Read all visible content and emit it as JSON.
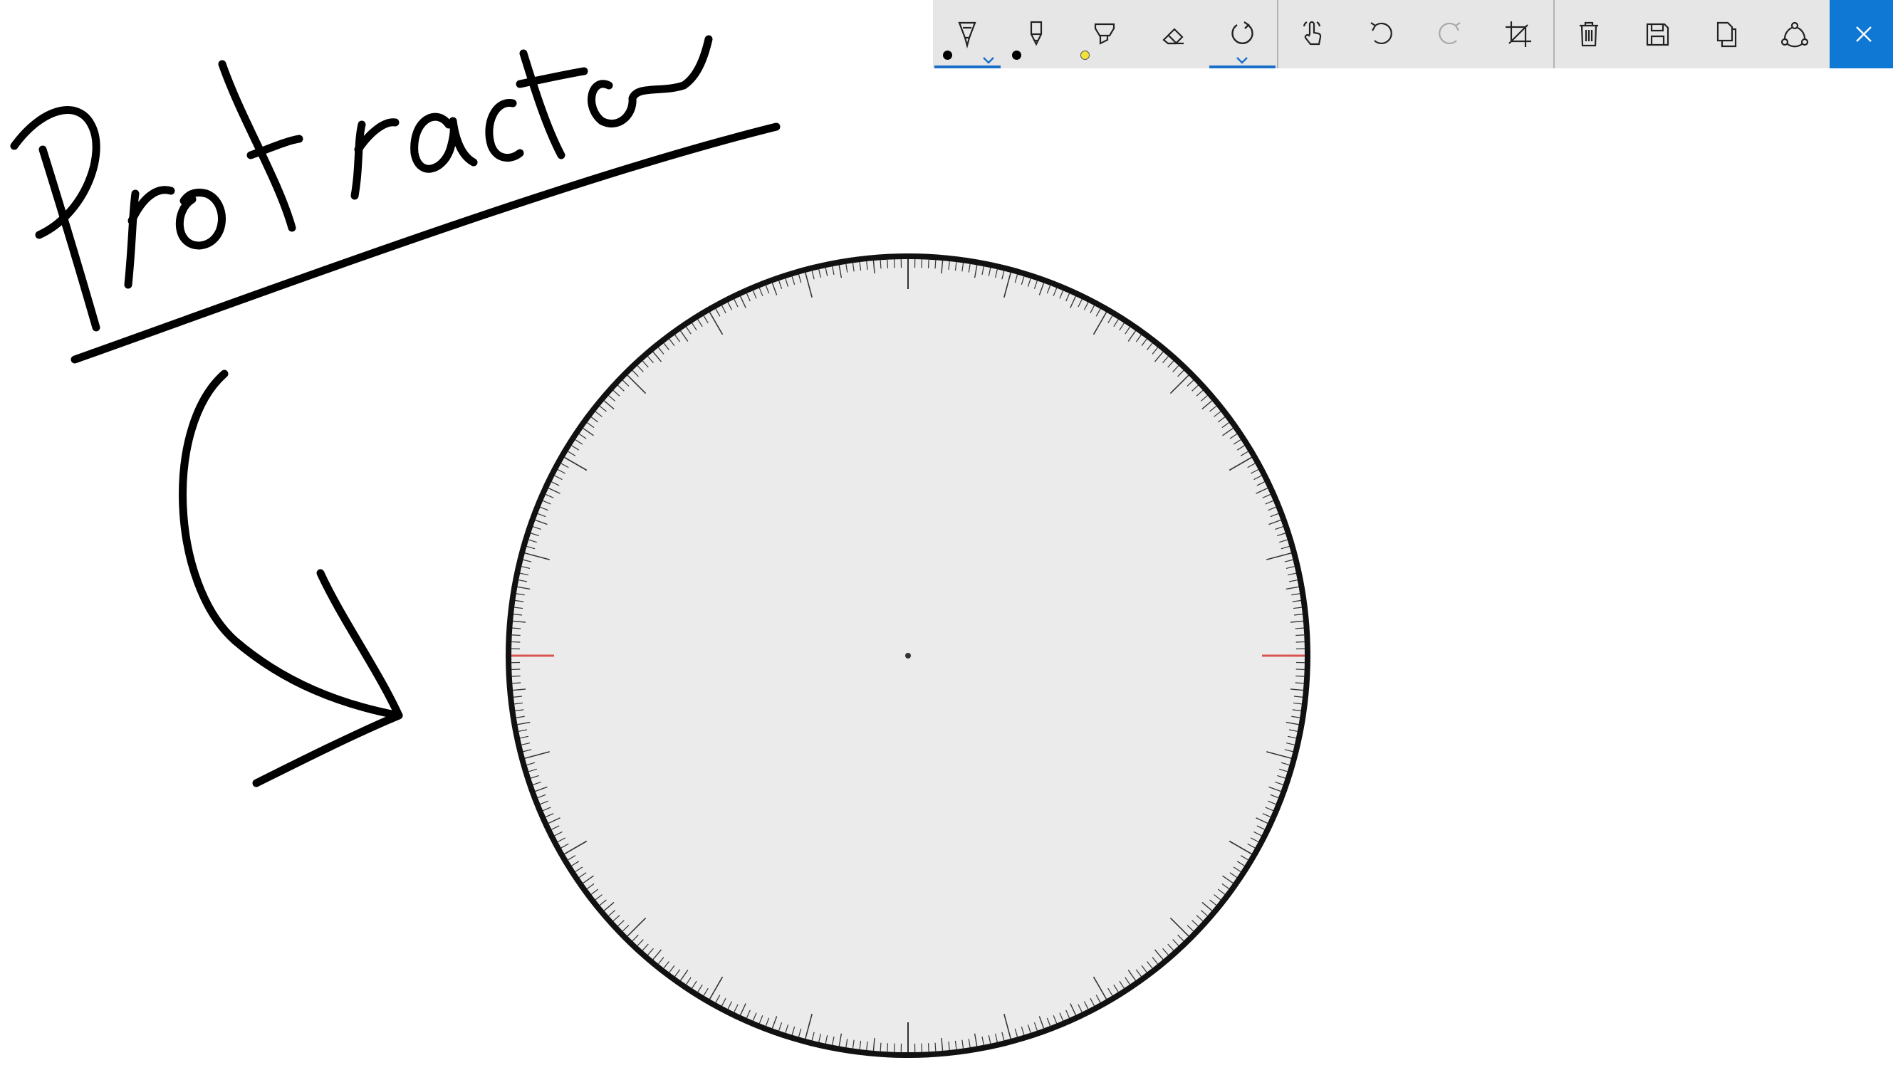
{
  "app": {
    "toolbar": {
      "tools": [
        {
          "name": "ballpoint-pen",
          "color": "#000000",
          "selected": true
        },
        {
          "name": "pencil",
          "color": "#000000",
          "selected": false
        },
        {
          "name": "highlighter",
          "color": "#f2e23a",
          "selected": false
        },
        {
          "name": "eraser",
          "selected": false
        },
        {
          "name": "ruler-protractor",
          "selected": true,
          "active_mode": "protractor"
        }
      ],
      "actions": [
        "touch-writing",
        "undo",
        "redo",
        "crop",
        "delete",
        "save",
        "copy",
        "share",
        "close"
      ],
      "accent_color": "#0f78d4",
      "redo_disabled": true
    }
  },
  "canvas": {
    "handwriting_text": "Protracto",
    "ink_color": "#000000",
    "protractor": {
      "fill": "#ebebeb",
      "rim_color": "#111111",
      "tick_color": "#333333",
      "zero_marker_color": "#d9534f"
    }
  }
}
